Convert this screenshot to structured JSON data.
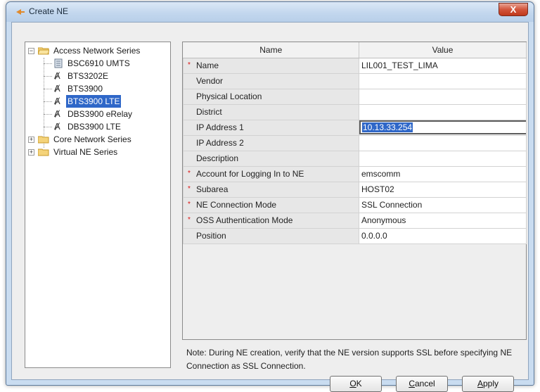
{
  "window": {
    "title": "Create NE",
    "close_label": "X"
  },
  "tree": {
    "root_access": "Access Network Series",
    "children": [
      {
        "label": "BSC6910 UMTS",
        "icon": "nodeb-icon"
      },
      {
        "label": "BTS3202E",
        "icon": "antenna-icon"
      },
      {
        "label": "BTS3900",
        "icon": "antenna-icon"
      },
      {
        "label": "BTS3900 LTE",
        "icon": "antenna-icon",
        "selected": true
      },
      {
        "label": "DBS3900 eRelay",
        "icon": "antenna-icon"
      },
      {
        "label": "DBS3900 LTE",
        "icon": "antenna-icon"
      }
    ],
    "root_core": "Core Network Series",
    "root_virtual": "Virtual NE Series"
  },
  "table": {
    "headers": {
      "name": "Name",
      "value": "Value"
    },
    "rows": [
      {
        "name": "Name",
        "value": "LIL001_TEST_LIMA",
        "required": true
      },
      {
        "name": "Vendor",
        "value": "",
        "required": false
      },
      {
        "name": "Physical Location",
        "value": "",
        "required": false
      },
      {
        "name": "District",
        "value": "",
        "required": false
      },
      {
        "name": "IP Address 1",
        "value": "10.13.33.254",
        "required": false,
        "editing": true
      },
      {
        "name": "IP Address 2",
        "value": "",
        "required": false
      },
      {
        "name": "Description",
        "value": "",
        "required": false
      },
      {
        "name": "Account for Logging In to NE",
        "value": "emscomm",
        "required": true
      },
      {
        "name": "Subarea",
        "value": "HOST02",
        "required": true
      },
      {
        "name": "NE Connection Mode",
        "value": "SSL Connection",
        "required": true
      },
      {
        "name": "OSS Authentication Mode",
        "value": "Anonymous",
        "required": true
      },
      {
        "name": "Position",
        "value": "0.0.0.0",
        "required": false
      }
    ],
    "required_marker": "*"
  },
  "note": "Note: During NE creation, verify that the NE version supports SSL before specifying NE Connection as SSL Connection.",
  "buttons": {
    "ok": {
      "mnemonic": "O",
      "rest": "K"
    },
    "cancel": {
      "mnemonic": "C",
      "rest": "ancel"
    },
    "apply": {
      "mnemonic": "A",
      "rest": "pply"
    }
  },
  "colors": {
    "selection": "#2f67c8",
    "required": "#dd1111",
    "close_button": "#d2553b"
  }
}
